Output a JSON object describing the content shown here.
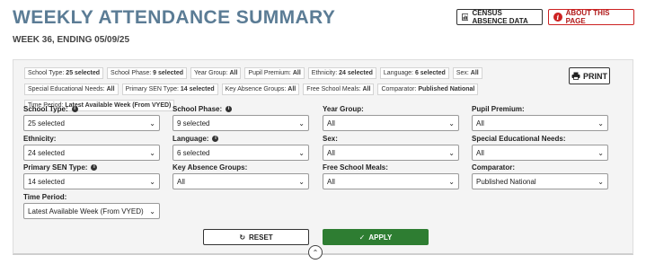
{
  "header": {
    "title": "WEEKLY ATTENDANCE SUMMARY",
    "subtitle": "WEEK 36, ENDING 05/09/25",
    "census_btn": "CENSUS ABSENCE DATA",
    "about_btn": "ABOUT THIS PAGE"
  },
  "chips": [
    {
      "k": "School Type:",
      "v": "25 selected"
    },
    {
      "k": "School Phase:",
      "v": "9 selected"
    },
    {
      "k": "Year Group:",
      "v": "All"
    },
    {
      "k": "Pupil Premium:",
      "v": "All"
    },
    {
      "k": "Ethnicity:",
      "v": "24 selected"
    },
    {
      "k": "Language:",
      "v": "6 selected"
    },
    {
      "k": "Sex:",
      "v": "All"
    },
    {
      "k": "Special Educational Needs:",
      "v": "All"
    },
    {
      "k": "Primary SEN Type:",
      "v": "14 selected"
    },
    {
      "k": "Key Absence Groups:",
      "v": "All"
    },
    {
      "k": "Free School Meals:",
      "v": "All"
    },
    {
      "k": "Comparator:",
      "v": "Published National"
    },
    {
      "k": "Time Period:",
      "v": "Latest Available Week (From VYED)"
    }
  ],
  "print_btn": "PRINT",
  "filters": {
    "school_type": {
      "label": "School Type:",
      "value": "25 selected"
    },
    "school_phase": {
      "label": "School Phase:",
      "value": "9 selected"
    },
    "year_group": {
      "label": "Year Group:",
      "value": "All"
    },
    "pupil_premium": {
      "label": "Pupil Premium:",
      "value": "All"
    },
    "ethnicity": {
      "label": "Ethnicity:",
      "value": "24 selected"
    },
    "language": {
      "label": "Language:",
      "value": "6 selected"
    },
    "sex": {
      "label": "Sex:",
      "value": "All"
    },
    "sen": {
      "label": "Special Educational Needs:",
      "value": "All"
    },
    "primary_sen_type": {
      "label": "Primary SEN Type:",
      "value": "14 selected"
    },
    "key_absence_groups": {
      "label": "Key Absence Groups:",
      "value": "All"
    },
    "free_school_meals": {
      "label": "Free School Meals:",
      "value": "All"
    },
    "comparator": {
      "label": "Comparator:",
      "value": "Published National"
    },
    "time_period": {
      "label": "Time Period:",
      "value": "Latest Available Week (From VYED)"
    }
  },
  "actions": {
    "reset": "RESET",
    "apply": "APPLY"
  },
  "colors": {
    "title": "#5b7c95",
    "apply": "#2e7d32",
    "about": "#c22222"
  }
}
